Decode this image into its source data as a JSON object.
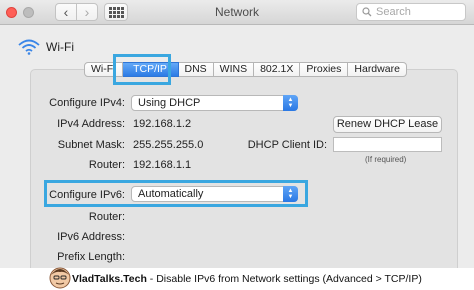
{
  "window": {
    "title": "Network",
    "search_placeholder": "Search"
  },
  "network": {
    "name": "Wi-Fi"
  },
  "tabs": [
    {
      "label": "Wi-Fi",
      "active": false
    },
    {
      "label": "TCP/IP",
      "active": true
    },
    {
      "label": "DNS",
      "active": false
    },
    {
      "label": "WINS",
      "active": false
    },
    {
      "label": "802.1X",
      "active": false
    },
    {
      "label": "Proxies",
      "active": false
    },
    {
      "label": "Hardware",
      "active": false
    }
  ],
  "ipv4": {
    "configure_label": "Configure IPv4:",
    "configure_value": "Using DHCP",
    "address_label": "IPv4 Address:",
    "address_value": "192.168.1.2",
    "subnet_label": "Subnet Mask:",
    "subnet_value": "255.255.255.0",
    "router_label": "Router:",
    "router_value": "192.168.1.1",
    "renew_button": "Renew DHCP Lease",
    "client_id_label": "DHCP Client ID:",
    "client_id_value": "",
    "client_id_note": "(If required)"
  },
  "ipv6": {
    "configure_label": "Configure IPv6:",
    "configure_value": "Automatically",
    "router_label": "Router:",
    "address_label": "IPv6 Address:",
    "prefix_label": "Prefix Length:"
  },
  "caption": {
    "brand": "VladTalks.Tech",
    "text": " - Disable IPv6 from Network settings (Advanced > TCP/IP)"
  },
  "colors": {
    "highlight": "#3aa7e0",
    "accent": "#2c7be5"
  }
}
